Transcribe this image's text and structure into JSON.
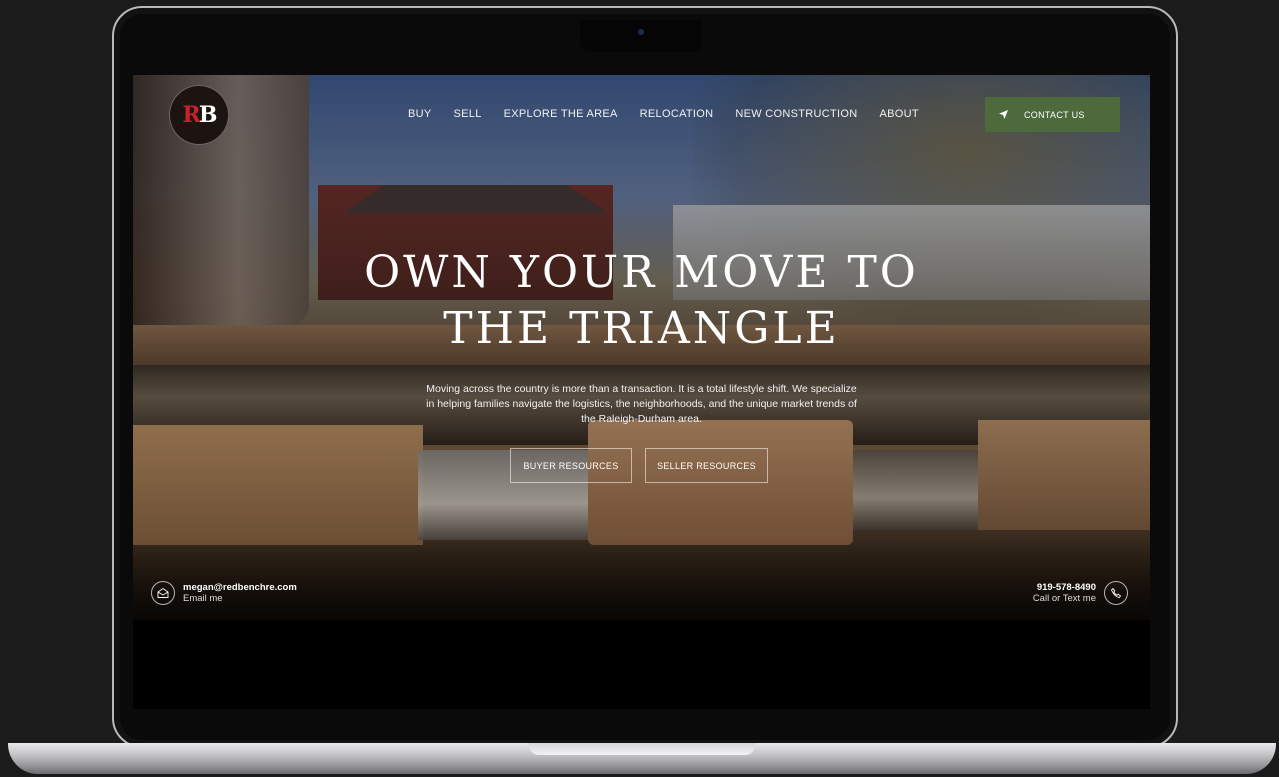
{
  "nav": {
    "items": [
      "BUY",
      "SELL",
      "EXPLORE THE AREA",
      "RELOCATION",
      "NEW CONSTRUCTION",
      "ABOUT"
    ],
    "contact_label": "CONTACT US"
  },
  "logo": {
    "text_r": "R",
    "text_b": "B"
  },
  "hero": {
    "title_line1": "OWN YOUR MOVE TO",
    "title_line2": "THE TRIANGLE",
    "subtitle": "Moving across the country is more than a transaction. It is a total lifestyle shift. We specialize in helping families navigate the logistics, the neighborhoods, and the unique market trends of the Raleigh-Durham area.",
    "buyer_btn": "BUYER RESOURCES",
    "seller_btn": "SELLER RESOURCES"
  },
  "contact": {
    "email": "megan@redbenchre.com",
    "email_sub": "Email me",
    "phone": "919-578-8490",
    "phone_sub": "Call or Text me"
  },
  "icons": [
    "mail-icon",
    "phone-icon",
    "navigation-arrow-icon"
  ],
  "colors": {
    "accent_green": "#4c6a3c",
    "logo_red": "#c4232b"
  }
}
